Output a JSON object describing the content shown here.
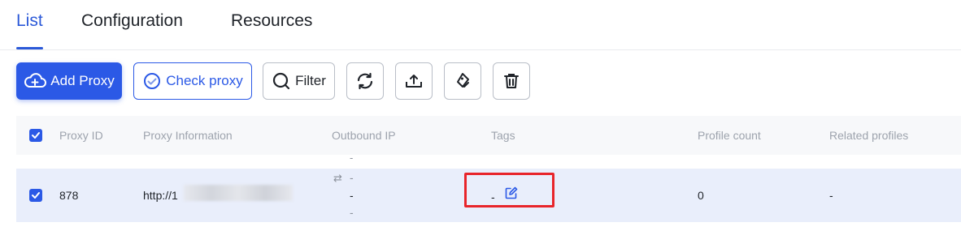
{
  "tabs": [
    {
      "label": "List",
      "active": true
    },
    {
      "label": "Configuration",
      "active": false
    },
    {
      "label": "Resources",
      "active": false
    }
  ],
  "toolbar": {
    "add_proxy_label": "Add Proxy",
    "check_proxy_label": "Check proxy",
    "filter_label": "Filter",
    "icons": [
      "cloud-plus-icon",
      "check-circle-icon",
      "search-icon",
      "refresh-icon",
      "upload-icon",
      "tag-edit-icon",
      "trash-icon"
    ]
  },
  "table": {
    "columns": [
      "Proxy ID",
      "Proxy Information",
      "Outbound IP",
      "Tags",
      "Profile count",
      "Related profiles"
    ],
    "header_checked": true,
    "above_row_outbound_dash": "-",
    "rows": [
      {
        "checked": true,
        "proxy_id": "878",
        "proxy_information": "http://1",
        "outbound_ip_lines": [
          "-",
          "-",
          "-"
        ],
        "tags": "-",
        "profile_count": "0",
        "related_profiles": "-"
      }
    ]
  },
  "colors": {
    "accent": "#2b59e6",
    "row_highlight": "#e9eefb",
    "annotation_box": "#e8242a"
  }
}
